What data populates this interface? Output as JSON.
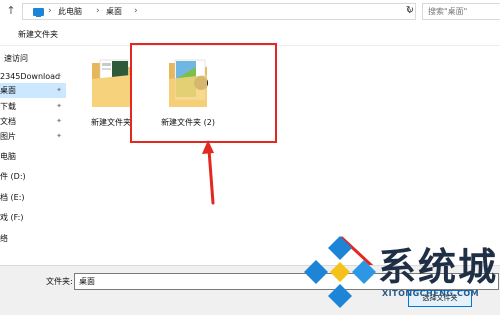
{
  "address_bar": {
    "breadcrumbs": [
      "此电脑",
      "桌面"
    ],
    "search_placeholder": "搜索\"桌面\""
  },
  "toolbar": {
    "new_folder_label": "新建文件夹"
  },
  "sidebar": {
    "items": [
      {
        "label": "速访问",
        "pinned": false,
        "selected": false
      },
      {
        "label": "2345Download",
        "pinned": true,
        "selected": false
      },
      {
        "label": "桌面",
        "pinned": true,
        "selected": true
      },
      {
        "label": "下载",
        "pinned": true,
        "selected": false
      },
      {
        "label": "文档",
        "pinned": true,
        "selected": false
      },
      {
        "label": "图片",
        "pinned": true,
        "selected": false
      },
      {
        "label": "电脑",
        "pinned": false,
        "selected": false
      },
      {
        "label": "件 (D:)",
        "pinned": false,
        "selected": false
      },
      {
        "label": "档 (E:)",
        "pinned": false,
        "selected": false
      },
      {
        "label": "戏 (F:)",
        "pinned": false,
        "selected": false
      },
      {
        "label": "络",
        "pinned": false,
        "selected": false
      }
    ]
  },
  "content": {
    "folders": [
      {
        "name": "新建文件夹"
      },
      {
        "name": "新建文件夹 (2)"
      }
    ]
  },
  "bottom": {
    "filename_label": "文件夹:",
    "filename_value": "桌面",
    "select_button_label": "选择文件夹"
  },
  "watermark": {
    "text": "系统城",
    "url": "XITONGCHENG.COM"
  },
  "colors": {
    "accent": "#0078d7",
    "selection": "#cce8ff",
    "annotation_red": "#e3281f",
    "watermark_blue": "#1e84d6"
  }
}
